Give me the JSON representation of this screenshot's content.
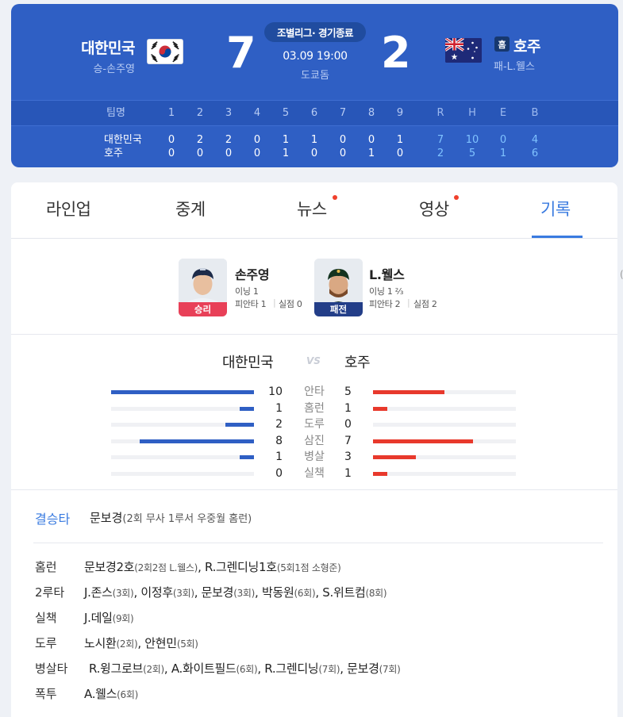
{
  "header": {
    "away_team": "대한민국",
    "away_sub": "승-손주영",
    "away_score": "7",
    "status": "조별리그· 경기종료",
    "datetime": "03.09 19:00",
    "venue": "도쿄돔",
    "home_score": "2",
    "home_badge": "홈",
    "home_team": "호주",
    "home_sub": "패-L.웰스"
  },
  "line_score": {
    "team_header": "팀명",
    "innings": [
      "1",
      "2",
      "3",
      "4",
      "5",
      "6",
      "7",
      "8",
      "9"
    ],
    "totals_header": [
      "R",
      "H",
      "E",
      "B"
    ],
    "rows": [
      {
        "team": "대한민국",
        "innings": [
          "0",
          "2",
          "2",
          "0",
          "1",
          "1",
          "0",
          "0",
          "1"
        ],
        "totals": [
          "7",
          "10",
          "0",
          "4"
        ]
      },
      {
        "team": "호주",
        "innings": [
          "0",
          "0",
          "0",
          "0",
          "1",
          "0",
          "0",
          "1",
          "0"
        ],
        "totals": [
          "2",
          "5",
          "1",
          "6"
        ]
      }
    ]
  },
  "tabs": [
    {
      "label": "라인업"
    },
    {
      "label": "중계"
    },
    {
      "label": "뉴스"
    },
    {
      "label": "영상"
    },
    {
      "label": "기록"
    }
  ],
  "pitchers": {
    "winner": {
      "name": "손주영",
      "badge": "승리",
      "stat1": "이닝 1",
      "stat2a": "피안타 1",
      "stat2b": "실점 0"
    },
    "loser": {
      "name": "L.웰스",
      "badge": "패전",
      "stat1": "이닝 1 ⅔",
      "stat2a": "피안타 2",
      "stat2b": "실점 2"
    }
  },
  "comparison": {
    "away": "대한민국",
    "vs": "VS",
    "home": "호주",
    "rows": [
      {
        "label": "안타",
        "away": 10,
        "home": 5
      },
      {
        "label": "홈런",
        "away": 1,
        "home": 1
      },
      {
        "label": "도루",
        "away": 2,
        "home": 0
      },
      {
        "label": "삼진",
        "away": 8,
        "home": 7
      },
      {
        "label": "병살",
        "away": 1,
        "home": 3
      },
      {
        "label": "실책",
        "away": 0,
        "home": 1
      }
    ]
  },
  "records": {
    "gw_label": "결승타",
    "gw_name": "문보경",
    "gw_detail": "(2회 무사 1루서 우중월 홈런)",
    "rows": [
      {
        "label": "홈런",
        "items": [
          [
            "문보경2호",
            "(2회2점 L.웰스)"
          ],
          [
            "R.그렌디닝1호",
            "(5회1점 소형준)"
          ]
        ]
      },
      {
        "label": "2루타",
        "items": [
          [
            "J.존스",
            "(3회)"
          ],
          [
            "이정후",
            "(3회)"
          ],
          [
            "문보경",
            "(3회)"
          ],
          [
            "박동원",
            "(6회)"
          ],
          [
            "S.위트컴",
            "(8회)"
          ]
        ]
      },
      {
        "label": "실책",
        "items": [
          [
            "J.데일",
            "(9회)"
          ]
        ]
      },
      {
        "label": "도루",
        "items": [
          [
            "노시환",
            "(2회)"
          ],
          [
            "안현민",
            "(5회)"
          ]
        ]
      },
      {
        "label": "병살타",
        "items": [
          [
            "R.윙그로브",
            "(2회)"
          ],
          [
            "A.화이트필드",
            "(6회)"
          ],
          [
            "R.그렌디닝",
            "(7회)"
          ],
          [
            "문보경",
            "(7회)"
          ]
        ]
      },
      {
        "label": "폭투",
        "items": [
          [
            "A.웰스",
            "(6회)"
          ]
        ]
      }
    ]
  },
  "colors": {
    "brand": "#2f5fc4",
    "accent": "#3a7be0",
    "away_bar": "#2f5fc4",
    "home_bar": "#e8392c"
  }
}
